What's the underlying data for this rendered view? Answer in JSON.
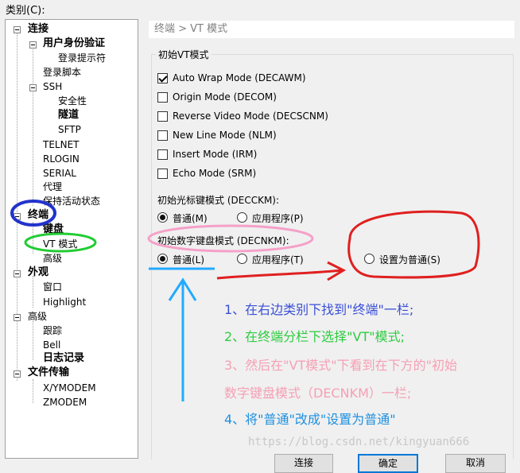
{
  "category_label": "类别(C):",
  "tree": {
    "connect": "连接",
    "auth": "用户身份验证",
    "login_prompt": "登录提示符",
    "login_script": "登录脚本",
    "ssh": "SSH",
    "security": "安全性",
    "tunnel": "隧道",
    "sftp": "SFTP",
    "telnet": "TELNET",
    "rlogin": "RLOGIN",
    "serial": "SERIAL",
    "proxy": "代理",
    "keepalive": "保持活动状态",
    "terminal": "终端",
    "keyboard": "键盘",
    "vt_mode": "VT 模式",
    "advanced": "高级",
    "appearance": "外观",
    "window": "窗口",
    "highlight": "Highlight",
    "advanced2": "高级",
    "trace": "跟踪",
    "bell": "Bell",
    "log": "日志记录",
    "file_transfer": "文件传输",
    "xymodem": "X/YMODEM",
    "zmodem": "ZMODEM"
  },
  "breadcrumb": "终端 > VT 模式",
  "group_title": "初始VT模式",
  "checkboxes": [
    {
      "label": "Auto Wrap Mode (DECAWM)",
      "checked": true
    },
    {
      "label": "Origin Mode (DECOM)",
      "checked": false
    },
    {
      "label": "Reverse Video Mode (DECSCNM)",
      "checked": false
    },
    {
      "label": "New Line Mode (NLM)",
      "checked": false
    },
    {
      "label": "Insert Mode (IRM)",
      "checked": false
    },
    {
      "label": "Echo Mode (SRM)",
      "checked": false
    }
  ],
  "cursor_keys": {
    "title": "初始光标键模式 (DECCKM):",
    "normal": "普通(M)",
    "app": "应用程序(P)"
  },
  "keypad": {
    "title": "初始数字键盘模式 (DECNKM):",
    "normal": "普通(L)",
    "app": "应用程序(T)",
    "set_normal": "设置为普通(S)"
  },
  "notes": {
    "n1": "1、在右边类别下找到\"终端\"一栏;",
    "n2": "2、在终端分栏下选择\"VT\"模式;",
    "n3a": "3、然后在\"VT模式\"下看到在下方的\"初始",
    "n3b": "数字键盘模式（DECNKM）一栏;",
    "n4": "4、将\"普通\"改成\"设置为普通\""
  },
  "watermark": "https://blog.csdn.net/kingyuan666",
  "buttons": {
    "connect": "连接",
    "ok": "确定",
    "cancel": "取消"
  },
  "colors": {
    "blue_note": "#3a50d8",
    "green_note": "#2ecc40",
    "pink_note": "#f5a0b4",
    "blue_note2": "#1e90e0",
    "red_mark": "#e02020",
    "cyan_mark": "#22aaff"
  }
}
